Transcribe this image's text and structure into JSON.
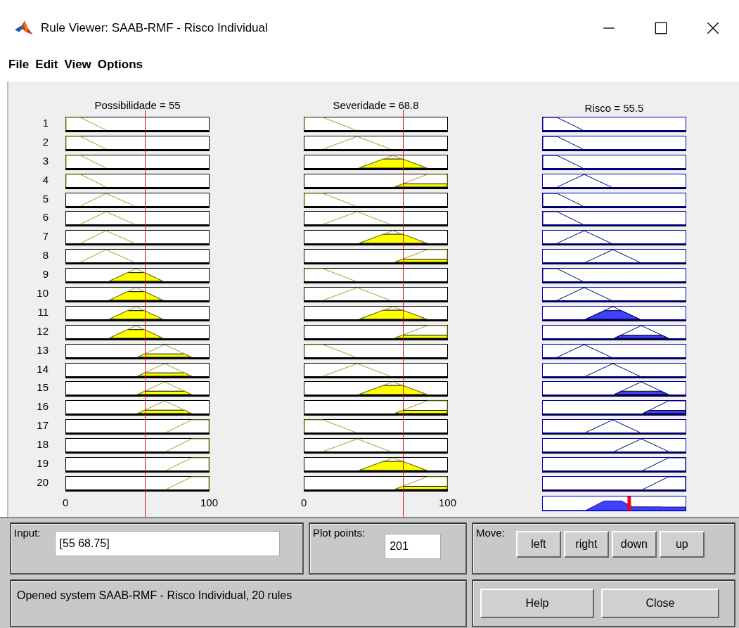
{
  "window": {
    "title": "Rule Viewer: SAAB-RMF - Risco Individual"
  },
  "menu": [
    "File",
    "Edit",
    "View",
    "Options"
  ],
  "variables": [
    {
      "title": "Possibilidade = 55",
      "kind": "input",
      "ticks": [
        "0",
        "100"
      ]
    },
    {
      "title": "Severidade = 68.8",
      "kind": "input",
      "ticks": [
        "0",
        "100"
      ]
    },
    {
      "title": "Risco = 55.5",
      "kind": "output"
    }
  ],
  "rules": [
    {
      "number": "1"
    },
    {
      "number": "2"
    },
    {
      "number": "3"
    },
    {
      "number": "4"
    },
    {
      "number": "5"
    },
    {
      "number": "6"
    },
    {
      "number": "7"
    },
    {
      "number": "8"
    },
    {
      "number": "9"
    },
    {
      "number": "10"
    },
    {
      "number": "11"
    },
    {
      "number": "12"
    },
    {
      "number": "13"
    },
    {
      "number": "14"
    },
    {
      "number": "15"
    },
    {
      "number": "16"
    },
    {
      "number": "17"
    },
    {
      "number": "18"
    },
    {
      "number": "19"
    },
    {
      "number": "20"
    }
  ],
  "input": {
    "label": "Input:",
    "value": "[55 68.75]"
  },
  "plot_points": {
    "label": "Plot points:",
    "value": "201"
  },
  "move": {
    "label": "Move:",
    "buttons": [
      "left",
      "right",
      "down",
      "up"
    ]
  },
  "status": "Opened system SAAB-RMF - Risco Individual, 20 rules",
  "buttons": [
    "Help",
    "Close"
  ]
}
